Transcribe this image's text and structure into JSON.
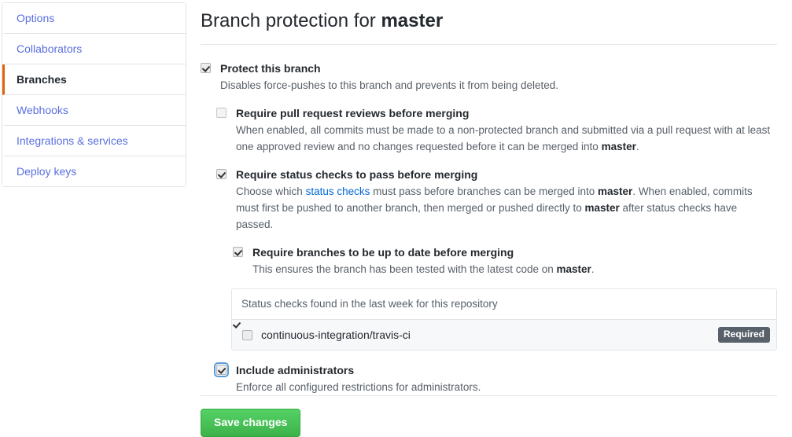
{
  "sidebar": {
    "items": [
      {
        "label": "Options",
        "active": false
      },
      {
        "label": "Collaborators",
        "active": false
      },
      {
        "label": "Branches",
        "active": true
      },
      {
        "label": "Webhooks",
        "active": false
      },
      {
        "label": "Integrations & services",
        "active": false
      },
      {
        "label": "Deploy keys",
        "active": false
      }
    ]
  },
  "header": {
    "title_prefix": "Branch protection for ",
    "branch_name": "master"
  },
  "settings": {
    "protect_branch": {
      "checked": true,
      "label": "Protect this branch",
      "description": "Disables force-pushes to this branch and prevents it from being deleted."
    },
    "require_pr_reviews": {
      "checked": false,
      "label": "Require pull request reviews before merging",
      "desc_part1": "When enabled, all commits must be made to a non-protected branch and submitted via a pull request with at least one approved review and no changes requested before it can be merged into ",
      "desc_branch": "master",
      "desc_part2": "."
    },
    "require_status_checks": {
      "checked": true,
      "label": "Require status checks to pass before merging",
      "desc_part1": "Choose which ",
      "desc_link": "status checks",
      "desc_part2": " must pass before branches can be merged into ",
      "desc_branch1": "master",
      "desc_part3": ". When enabled, commits must first be pushed to another branch, then merged or pushed directly to ",
      "desc_branch2": "master",
      "desc_part4": " after status checks have passed."
    },
    "require_up_to_date": {
      "checked": true,
      "label": "Require branches to be up to date before merging",
      "desc_part1": "This ensures the branch has been tested with the latest code on ",
      "desc_branch": "master",
      "desc_part2": "."
    },
    "include_administrators": {
      "checked": true,
      "focused": true,
      "label": "Include administrators",
      "description": "Enforce all configured restrictions for administrators."
    }
  },
  "status_checks_panel": {
    "header": "Status checks found in the last week for this repository",
    "rows": [
      {
        "checked": true,
        "name": "continuous-integration/travis-ci",
        "badge": "Required"
      }
    ]
  },
  "actions": {
    "save_label": "Save changes"
  },
  "colors": {
    "link": "#5b6fe0",
    "inline_link": "#0366d6",
    "active_indicator": "#e36209",
    "save_button": "#3cb34a",
    "badge_bg": "#586069",
    "border": "#e1e4e8",
    "muted_text": "#586069",
    "row_bg": "#f6f8fa"
  }
}
